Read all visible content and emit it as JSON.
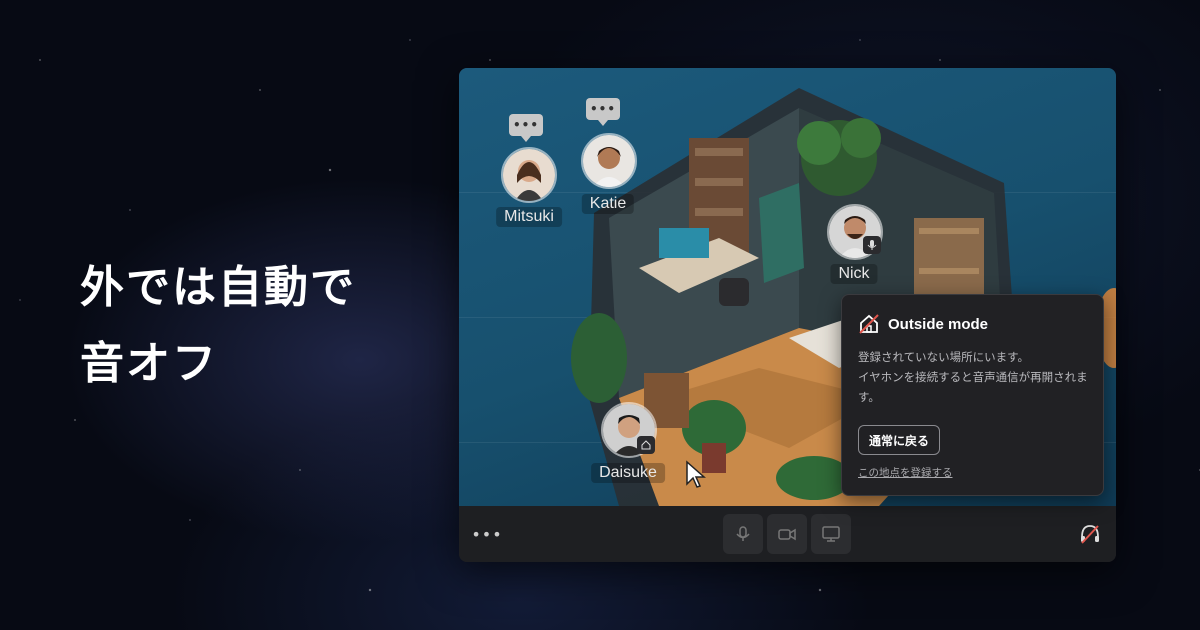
{
  "headline": {
    "line1": "外では自動で",
    "line2": "音オフ"
  },
  "participants": [
    {
      "name": "Mitsuki",
      "chat_bubble": "•••"
    },
    {
      "name": "Katie",
      "chat_bubble": "•••"
    },
    {
      "name": "Nick",
      "status_icon": "mic-icon"
    },
    {
      "name": "Daisuke",
      "status_icon": "home-icon"
    }
  ],
  "popover": {
    "title": "Outside mode",
    "body_line1": "登録されていない場所にいます。",
    "body_line2": "イヤホンを接続すると音声通信が再開されます。",
    "return_button": "通常に戻る",
    "register_link": "この地点を登録する"
  },
  "toolbar": {
    "more_label": "•••",
    "controls": [
      "mic-icon",
      "camera-icon",
      "screen-share-icon"
    ],
    "headphone_status": "headphones-off-icon"
  },
  "colors": {
    "accent_red": "#e0564d",
    "panel": "#212124",
    "scene": "#17506e"
  }
}
